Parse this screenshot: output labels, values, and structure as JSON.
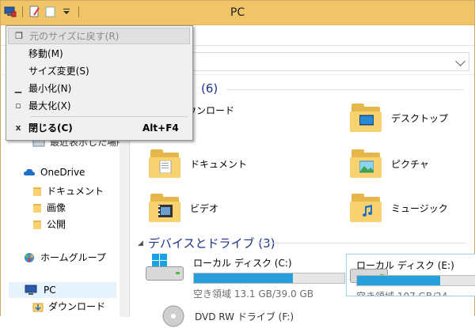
{
  "window": {
    "title": "PC"
  },
  "system_menu": {
    "items": [
      {
        "label": "元のサイズに戻す(R)",
        "icon": "restore-icon",
        "disabled": true
      },
      {
        "label": "移動(M)",
        "icon": "",
        "disabled": false
      },
      {
        "label": "サイズ変更(S)",
        "icon": "",
        "disabled": false
      },
      {
        "label": "最小化(N)",
        "icon": "minimize-icon",
        "disabled": false
      },
      {
        "label": "最大化(X)",
        "icon": "maximize-icon",
        "disabled": false
      },
      {
        "label": "閉じる(C)",
        "icon": "close-icon",
        "disabled": false,
        "shortcut": "Alt+F4"
      }
    ]
  },
  "nav": {
    "recent_partial": "最近表示した場所",
    "onedrive": "OneDrive",
    "onedrive_children": [
      "ドキュメント",
      "画像",
      "公開"
    ],
    "homegroup": "ホームグループ",
    "pc": "PC",
    "pc_children": [
      "ダウンロード"
    ]
  },
  "main": {
    "folders_header": "(6)",
    "folders": [
      {
        "label": "ダウンロード"
      },
      {
        "label": "デスクトップ"
      },
      {
        "label": "ドキュメント"
      },
      {
        "label": "ピクチャ"
      },
      {
        "label": "ビデオ"
      },
      {
        "label": "ミュージック"
      }
    ],
    "drives_header": "デバイスとドライブ (3)",
    "drives": [
      {
        "name": "ローカル ディスク (C:)",
        "space": "空き領域 13.1 GB/39.0 GB",
        "used_fraction": 0.66
      },
      {
        "name": "ローカル ディスク (E:)",
        "space": "空き領域 107 GB/24",
        "used_fraction": 0.55
      }
    ],
    "dvd_partial": "DVD RW ドライブ (F:)"
  },
  "colors": {
    "titlebar": "#f0c567",
    "accent": "#26a0da",
    "header_text": "#1e3287"
  }
}
